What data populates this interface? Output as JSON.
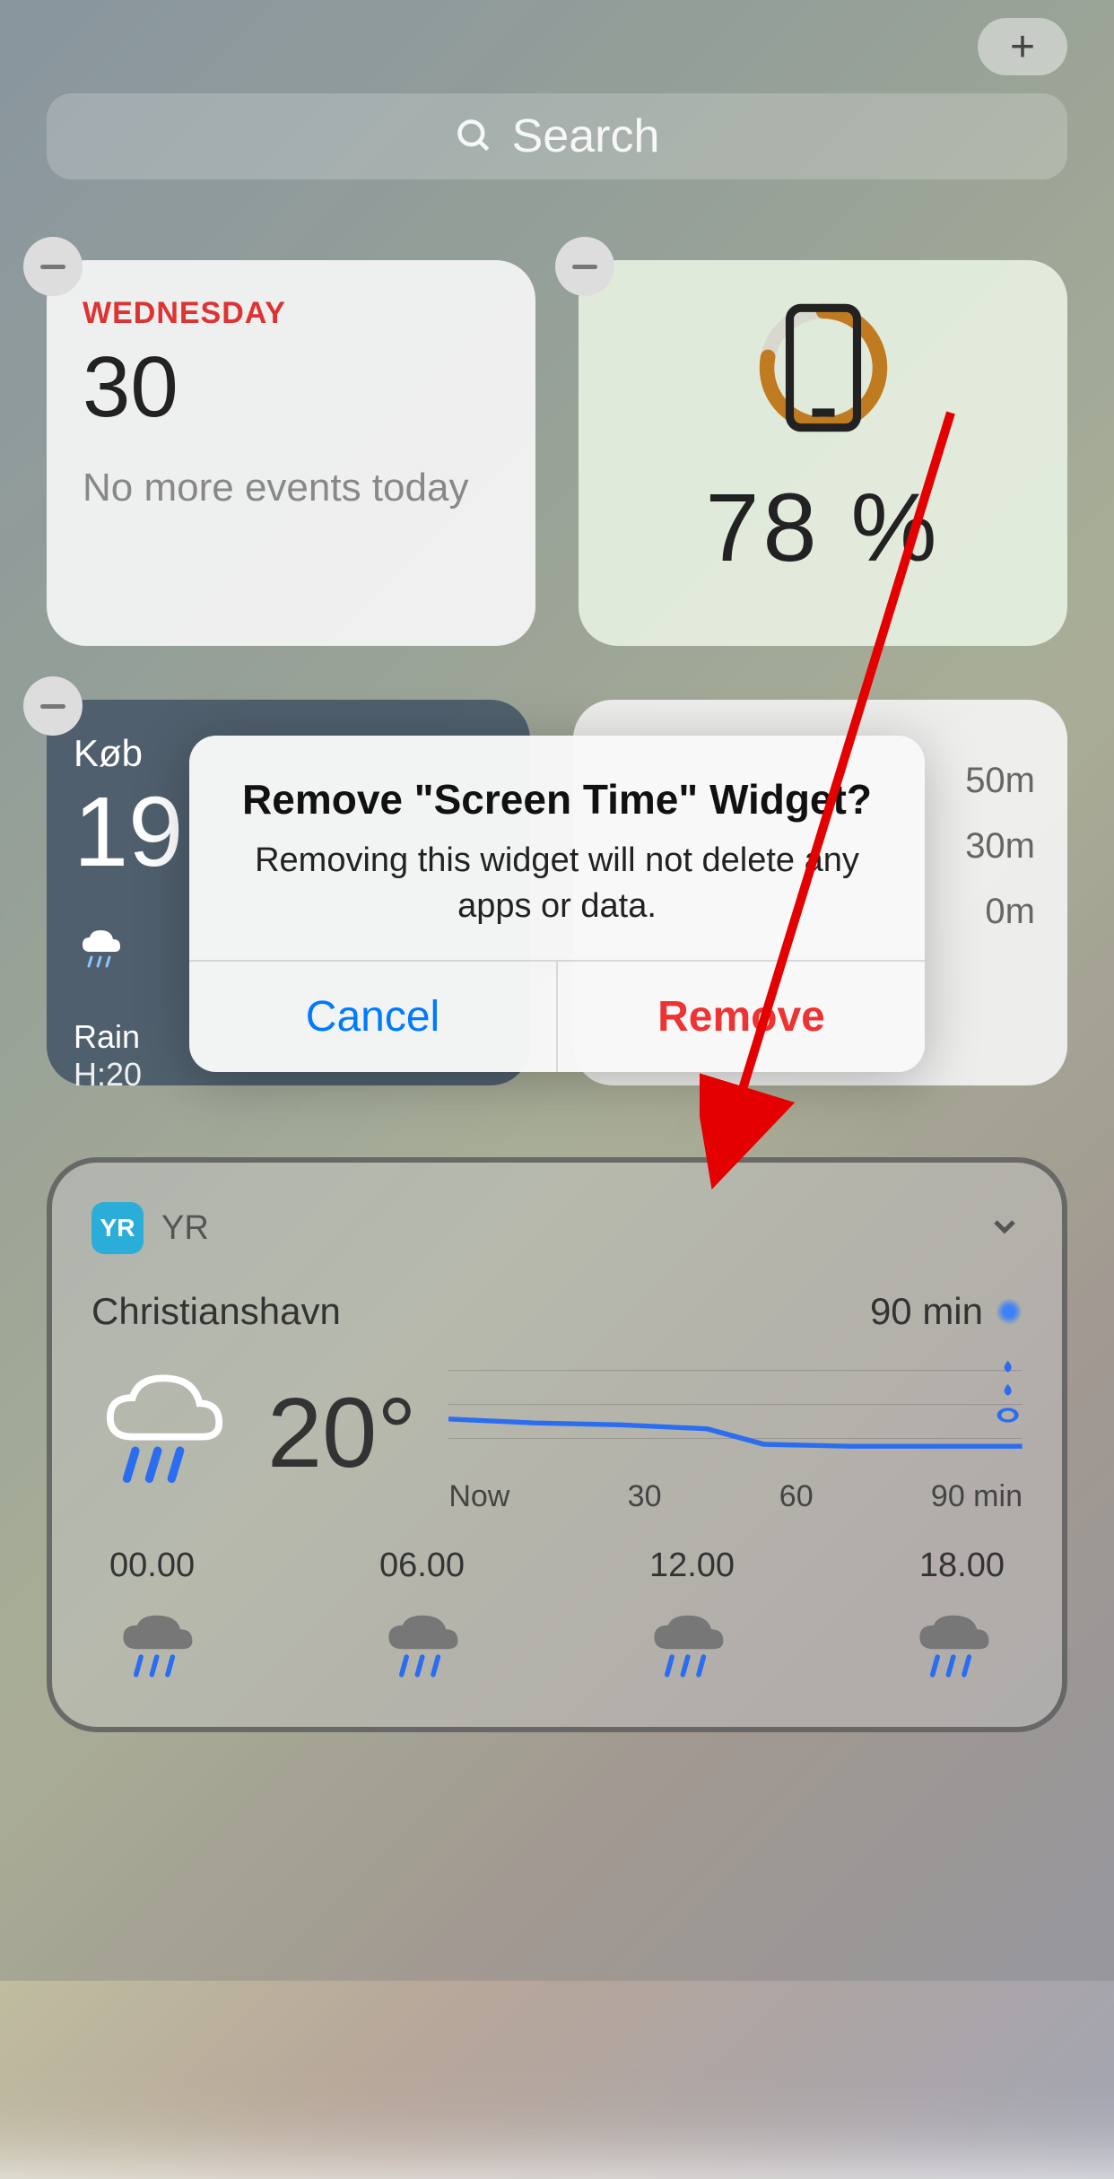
{
  "topBar": {
    "addIcon": "plus"
  },
  "search": {
    "placeholder": "Search"
  },
  "widgets": {
    "calendar": {
      "dayName": "WEDNESDAY",
      "dayNumber": "30",
      "eventsText": "No more events today"
    },
    "screenTime": {
      "percentText": "78 %",
      "ringProgress": 0.78,
      "ringColor": "#c07a1f"
    },
    "weatherSmall": {
      "city": "Køb",
      "temperature": "19",
      "condition": "Rain",
      "highLow": "H:20"
    },
    "barsWidget": {
      "rows": [
        "50m",
        "30m",
        "0m"
      ]
    }
  },
  "yr": {
    "appName": "YR",
    "location": "Christianshavn",
    "radarLabel": "90 min",
    "temperature": "20°",
    "chartLabels": [
      "Now",
      "30",
      "60",
      "90 min"
    ],
    "hours": [
      "00.00",
      "06.00",
      "12.00",
      "18.00"
    ]
  },
  "dialog": {
    "title": "Remove \"Screen Time\" Widget?",
    "message": "Removing this widget will not delete any apps or data.",
    "cancelLabel": "Cancel",
    "removeLabel": "Remove"
  },
  "colors": {
    "systemBlue": "#007aff",
    "systemRed": "#e33",
    "calendarRed": "#d33"
  }
}
